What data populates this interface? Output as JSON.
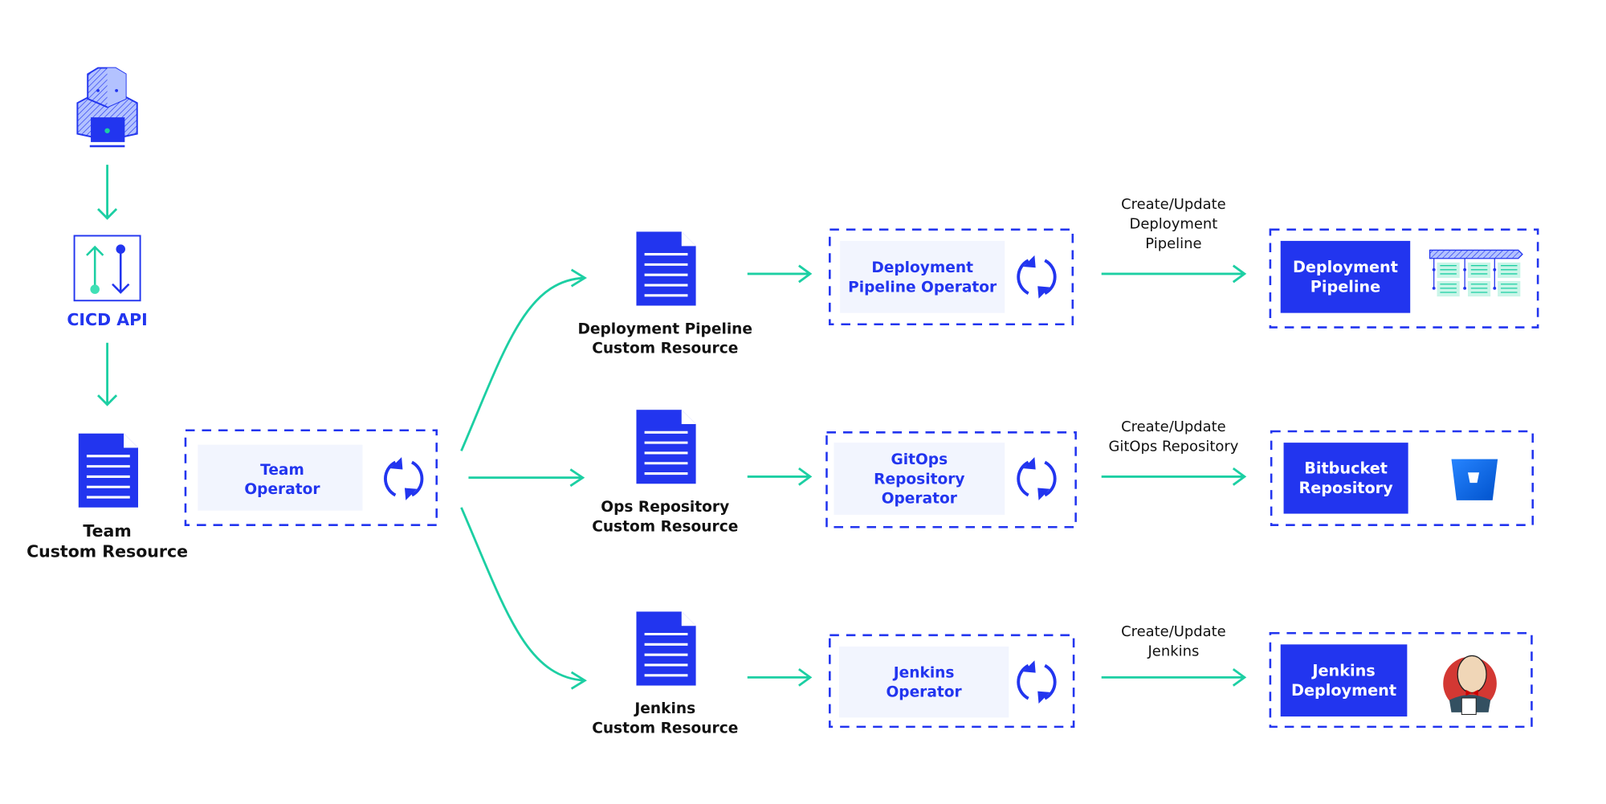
{
  "colors": {
    "primary": "#2235ef",
    "accent": "#1ccfa3",
    "panel": "#f2f5fe"
  },
  "user": {
    "icon": "developer-icon"
  },
  "cicd_api": {
    "label": "CICD API",
    "icon": "api-arrows-icon"
  },
  "team_resource": {
    "line1": "Team",
    "line2": "Custom Resource",
    "icon": "document-icon"
  },
  "team_operator": {
    "line1": "Team",
    "line2": "Operator",
    "icon": "sync-icon"
  },
  "rows": [
    {
      "resource": {
        "line1": "Deployment Pipeline",
        "line2": "Custom Resource"
      },
      "operator": {
        "lines": [
          "Deployment",
          "Pipeline Operator"
        ]
      },
      "action": {
        "lines": [
          "Create/Update",
          "Deployment",
          "Pipeline"
        ]
      },
      "target": {
        "lines": [
          "Deployment",
          "Pipeline"
        ],
        "icon": "pipeline-icon"
      }
    },
    {
      "resource": {
        "line1": "Ops Repository",
        "line2": "Custom Resource"
      },
      "operator": {
        "lines": [
          "GitOps",
          "Repository",
          "Operator"
        ]
      },
      "action": {
        "lines": [
          "Create/Update",
          "GitOps Repository"
        ]
      },
      "target": {
        "lines": [
          "Bitbucket",
          "Repository"
        ],
        "icon": "bitbucket-icon"
      }
    },
    {
      "resource": {
        "line1": "Jenkins",
        "line2": "Custom Resource"
      },
      "operator": {
        "lines": [
          "Jenkins",
          "Operator"
        ]
      },
      "action": {
        "lines": [
          "Create/Update",
          "Jenkins"
        ]
      },
      "target": {
        "lines": [
          "Jenkins",
          "Deployment"
        ],
        "icon": "jenkins-icon"
      }
    }
  ]
}
